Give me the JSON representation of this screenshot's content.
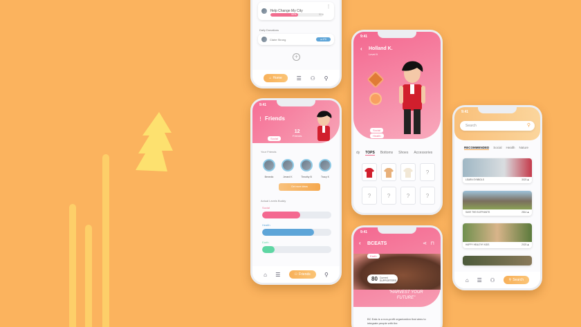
{
  "colors": {
    "background": "#fbb35e",
    "pink": "#f46890",
    "orange": "#f5a84e",
    "blue": "#5ea5d8",
    "green": "#5ed6a3"
  },
  "phone_a": {
    "row1_title": "Help Change My City",
    "row1_progress": {
      "fill": 0.52,
      "value_label": "52%",
      "right_label": "51%"
    },
    "section_label": "Daily Donations",
    "row2_name": "Claire Strong",
    "row2_pill": "● 470",
    "add_icon": "plus-circle-icon",
    "nav": {
      "home_label": "Home"
    }
  },
  "phone_b": {
    "time": "9:41",
    "title": "Friends",
    "badge": "Social",
    "count": "12",
    "count_label": "Friends",
    "friends_label": "Your Friends",
    "friends": [
      "Benedic",
      "Jerard K",
      "Timothy B",
      "Tracy K"
    ],
    "button_label": "Get more ideas",
    "levels_label": "Actual Levels Buddy",
    "levels": [
      {
        "name": "Social",
        "fill": 0.55
      },
      {
        "name": "Health",
        "fill": 0.75
      },
      {
        "name": "Earth",
        "fill": 0.18
      }
    ],
    "nav": {
      "active_label": "Friends"
    }
  },
  "phone_c": {
    "time": "9:41",
    "name": "Holland K.",
    "level": "Level 9",
    "tags": [
      "Social",
      "Health"
    ],
    "tabs": [
      "dy",
      "TOPS",
      "Bottoms",
      "Shoes",
      "Accessories"
    ],
    "active_tab": "TOPS",
    "grid": [
      "shirt-red",
      "shirt-stripe",
      "shirt-plain",
      "?",
      "?",
      "?",
      "?",
      "?"
    ]
  },
  "phone_d": {
    "time": "9:41",
    "title": "BCEATS",
    "tag": "Earth",
    "supporters_count": "80",
    "supporters_label": "Current SUPPORTERS",
    "quote": "\"HARVEST YOUR FUTURE\"",
    "body": "BC Eats is a non-profit organization that aims to integrate people with the"
  },
  "phone_e": {
    "time": "9:41",
    "search_placeholder": "Search",
    "section": "RECOMMENDED",
    "tabs": [
      "RECOMMENDED",
      "Social",
      "Health",
      "Nature"
    ],
    "cards": [
      {
        "caption": "LEARN SYMBOLS",
        "meta": "3023 ♟"
      },
      {
        "caption": "SAVE THE ELEPHANTS",
        "meta": "2814 ♟"
      },
      {
        "caption": "HAPPY HEALTHY KIDS",
        "meta": "2023 ♟"
      },
      {
        "caption": "",
        "meta": ""
      }
    ],
    "nav": {
      "active_label": "Search"
    }
  }
}
